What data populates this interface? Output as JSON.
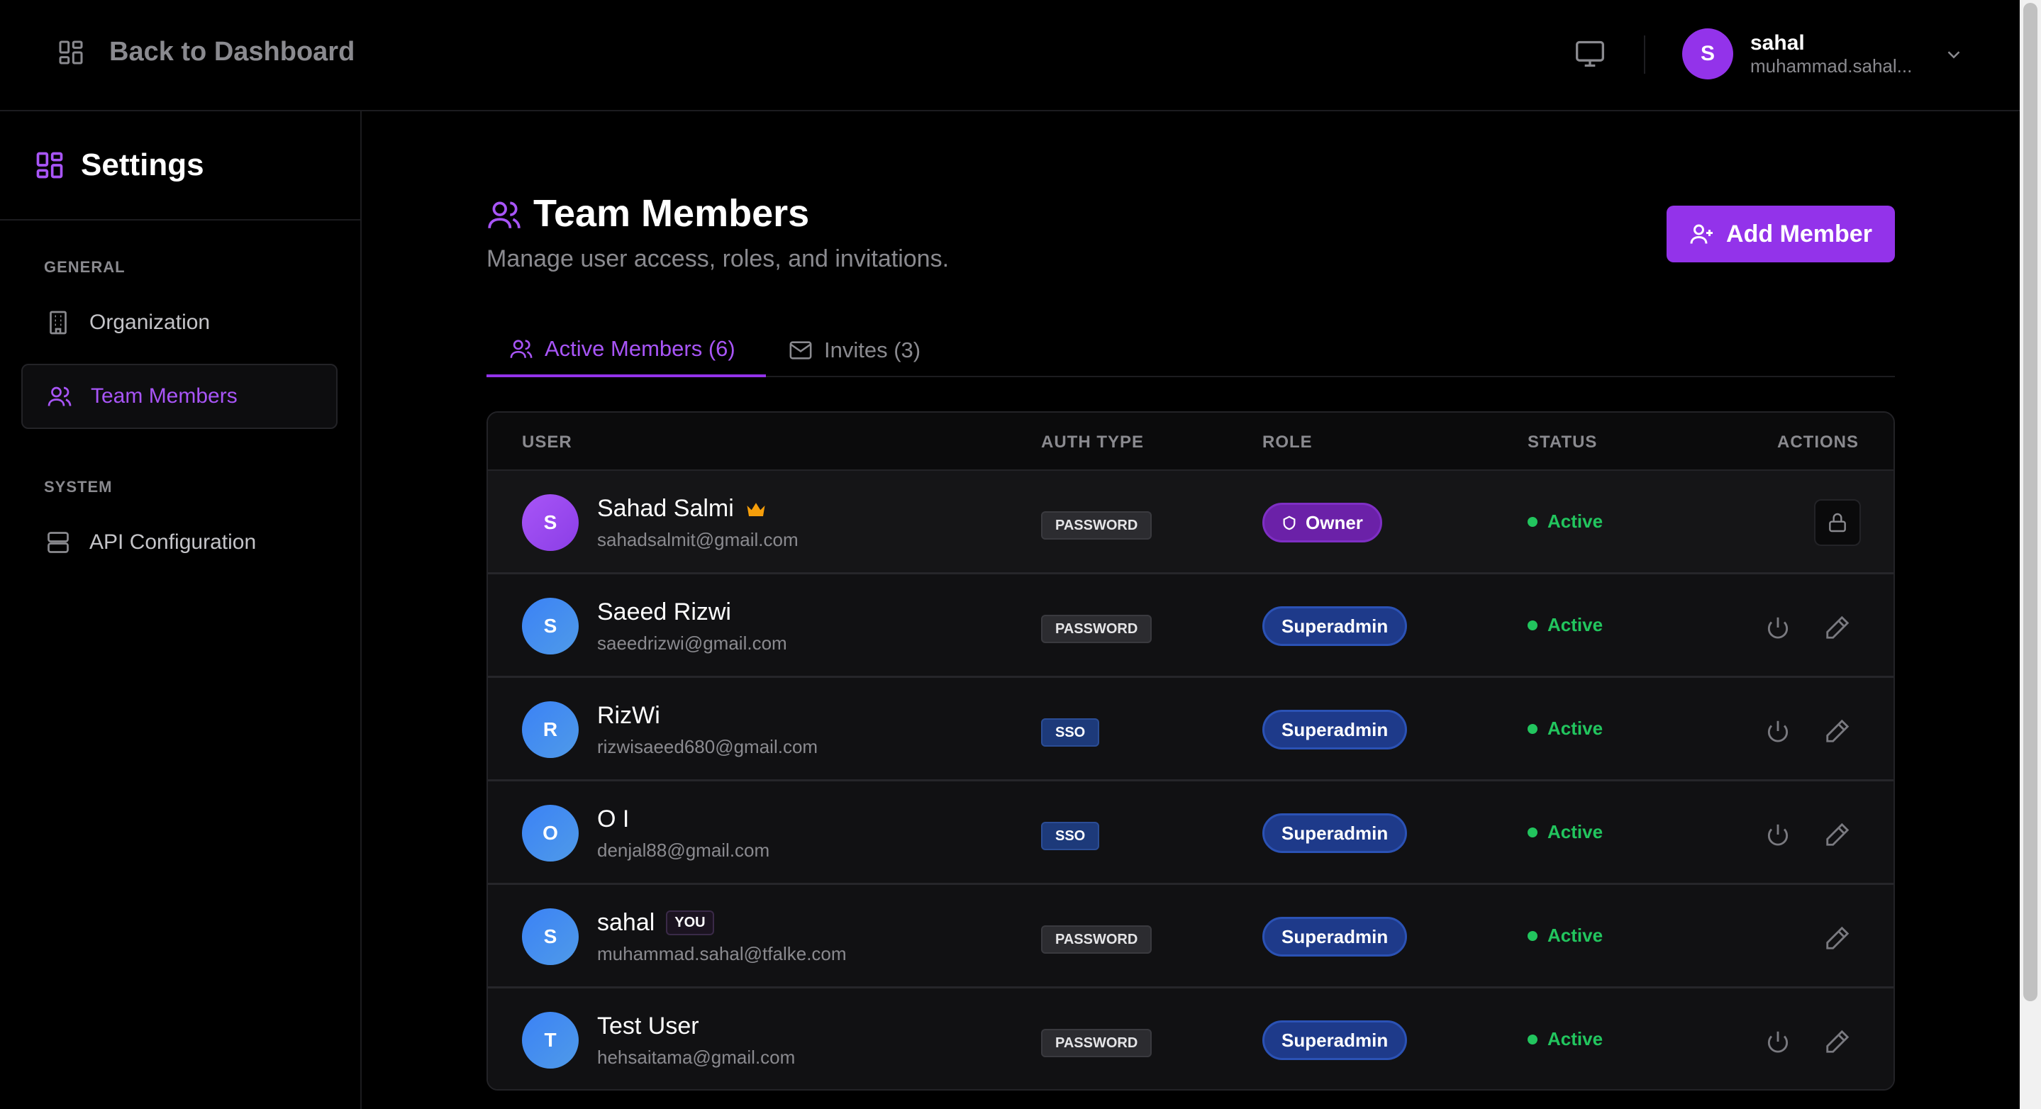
{
  "topbar": {
    "back_label": "Back to Dashboard",
    "user": {
      "initial": "S",
      "name": "sahal",
      "email": "muhammad.sahal..."
    }
  },
  "sidebar": {
    "title": "Settings",
    "sections": [
      {
        "label": "GENERAL",
        "items": [
          {
            "label": "Organization",
            "icon": "building-icon"
          },
          {
            "label": "Team Members",
            "icon": "users-icon",
            "active": true
          }
        ]
      },
      {
        "label": "SYSTEM",
        "items": [
          {
            "label": "API Configuration",
            "icon": "server-icon"
          }
        ]
      }
    ]
  },
  "page": {
    "title": "Team Members",
    "subtitle": "Manage user access, roles, and invitations.",
    "add_button": "Add Member"
  },
  "tabs": [
    {
      "label": "Active Members (6)",
      "active": true
    },
    {
      "label": "Invites (3)",
      "active": false
    }
  ],
  "table": {
    "headers": [
      "USER",
      "AUTH TYPE",
      "ROLE",
      "STATUS",
      "ACTIONS"
    ],
    "rows": [
      {
        "initial": "S",
        "name": "Sahad Salmi",
        "email": "sahadsalmit@gmail.com",
        "auth": "PASSWORD",
        "role": "Owner",
        "status": "Active",
        "crown": true
      },
      {
        "initial": "S",
        "name": "Saeed Rizwi",
        "email": "saeedrizwi@gmail.com",
        "auth": "PASSWORD",
        "role": "Superadmin",
        "status": "Active"
      },
      {
        "initial": "R",
        "name": "RizWi",
        "email": "rizwisaeed680@gmail.com",
        "auth": "SSO",
        "role": "Superadmin",
        "status": "Active"
      },
      {
        "initial": "O",
        "name": "O I",
        "email": "denjal88@gmail.com",
        "auth": "SSO",
        "role": "Superadmin",
        "status": "Active"
      },
      {
        "initial": "S",
        "name": "sahal",
        "email": "muhammad.sahal@tfalke.com",
        "auth": "PASSWORD",
        "role": "Superadmin",
        "status": "Active",
        "you_badge": "YOU"
      },
      {
        "initial": "T",
        "name": "Test User",
        "email": "hehsaitama@gmail.com",
        "auth": "PASSWORD",
        "role": "Superadmin",
        "status": "Active"
      }
    ]
  },
  "colors": {
    "accent": "#9333ea",
    "active_status": "#22c55e",
    "role_superadmin": "#1e3a8a",
    "role_owner": "#6b21a8"
  }
}
